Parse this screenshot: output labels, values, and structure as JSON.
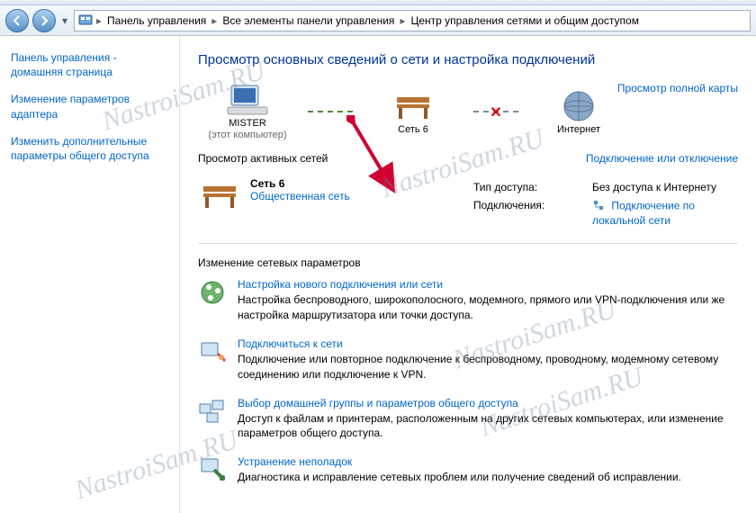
{
  "breadcrumb": {
    "items": [
      "Панель управления",
      "Все элементы панели управления",
      "Центр управления сетями и общим доступом"
    ]
  },
  "sidebar": {
    "links": [
      "Панель управления - домашняя страница",
      "Изменение параметров адаптера",
      "Изменить дополнительные параметры общего доступа"
    ]
  },
  "main": {
    "heading": "Просмотр основных сведений о сети и настройка подключений",
    "full_map": "Просмотр полной карты",
    "map": {
      "computer": {
        "name": "MISTER",
        "sub": "(этот компьютер)"
      },
      "network": {
        "name": "Сеть 6"
      },
      "internet": {
        "name": "Интернет"
      }
    },
    "active_networks_label": "Просмотр активных сетей",
    "connect_disconnect": "Подключение или отключение",
    "active_network": {
      "name": "Сеть 6",
      "type": "Общественная сеть",
      "access_label": "Тип доступа:",
      "access_value": "Без доступа к Интернету",
      "conn_label": "Подключения:",
      "conn_value": "Подключение по локальной сети"
    },
    "settings_heading": "Изменение сетевых параметров",
    "settings": [
      {
        "title": "Настройка нового подключения или сети",
        "desc": "Настройка беспроводного, широкополосного, модемного, прямого или VPN-подключения или же настройка маршрутизатора или точки доступа."
      },
      {
        "title": "Подключиться к сети",
        "desc": "Подключение или повторное подключение к беспроводному, проводному, модемному сетевому соединению или подключение к VPN."
      },
      {
        "title": "Выбор домашней группы и параметров общего доступа",
        "desc": "Доступ к файлам и принтерам, расположенным на других сетевых компьютерах, или изменение параметров общего доступа."
      },
      {
        "title": "Устранение неполадок",
        "desc": "Диагностика и исправление сетевых проблем или получение сведений об исправлении."
      }
    ]
  },
  "watermark": "NastroiSam.RU"
}
